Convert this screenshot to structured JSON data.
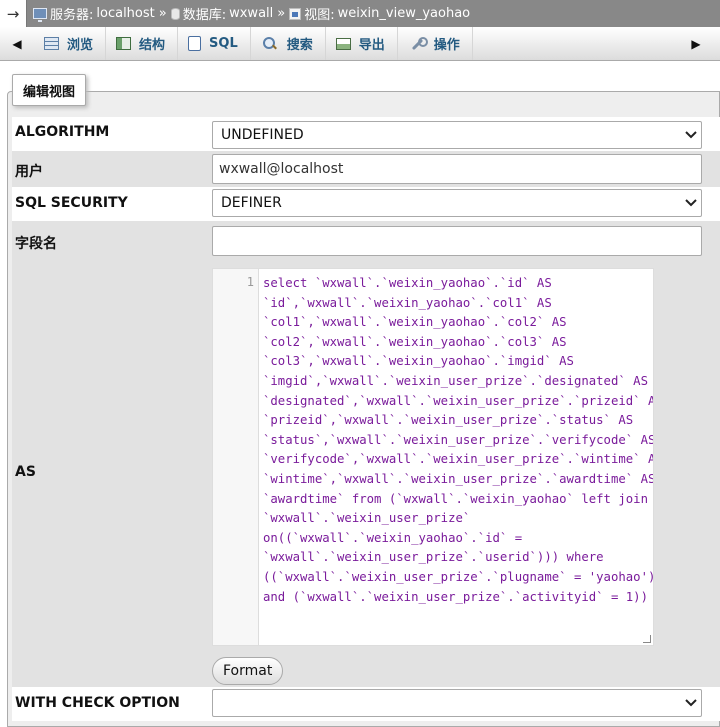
{
  "breadcrumb": {
    "server_label": "服务器:",
    "server_value": "localhost",
    "db_label": "数据库:",
    "db_value": "wxwall",
    "view_label": "视图:",
    "view_value": "weixin_view_yaohao",
    "sep": "»"
  },
  "tabs": [
    {
      "label": "浏览",
      "icon": "browse-icon"
    },
    {
      "label": "结构",
      "icon": "structure-icon"
    },
    {
      "label": "SQL",
      "icon": "sql-icon"
    },
    {
      "label": "搜索",
      "icon": "search-icon"
    },
    {
      "label": "导出",
      "icon": "export-icon"
    },
    {
      "label": "操作",
      "icon": "wrench-icon"
    }
  ],
  "fieldset": {
    "legend": "编辑视图"
  },
  "form": {
    "algorithm_label": "ALGORITHM",
    "algorithm_value": "UNDEFINED",
    "user_label": "用户",
    "user_value": "wxwall@localhost",
    "security_label": "SQL SECURITY",
    "security_value": "DEFINER",
    "column_names_label": "字段名",
    "column_names_value": "",
    "as_label": "AS",
    "as_line_number": "1",
    "as_code_lines": [
      "select `wxwall`.`weixin_yaohao`.`id` AS",
      "`id`,`wxwall`.`weixin_yaohao`.`col1` AS",
      "`col1`,`wxwall`.`weixin_yaohao`.`col2` AS",
      "`col2`,`wxwall`.`weixin_yaohao`.`col3` AS",
      "`col3`,`wxwall`.`weixin_yaohao`.`imgid` AS",
      "`imgid`,`wxwall`.`weixin_user_prize`.`designated` AS",
      "`designated`,`wxwall`.`weixin_user_prize`.`prizeid` AS",
      "`prizeid`,`wxwall`.`weixin_user_prize`.`status` AS",
      "`status`,`wxwall`.`weixin_user_prize`.`verifycode` AS",
      "`verifycode`,`wxwall`.`weixin_user_prize`.`wintime` AS",
      "`wintime`,`wxwall`.`weixin_user_prize`.`awardtime` AS",
      "`awardtime` from (`wxwall`.`weixin_yaohao` left join",
      "`wxwall`.`weixin_user_prize`",
      "on((`wxwall`.`weixin_yaohao`.`id` =",
      "`wxwall`.`weixin_user_prize`.`userid`))) where",
      "((`wxwall`.`weixin_user_prize`.`plugname` = 'yaohao')",
      "and (`wxwall`.`weixin_user_prize`.`activityid` = 1))"
    ],
    "format_button": "Format",
    "check_option_label": "WITH CHECK OPTION",
    "check_option_value": ""
  },
  "colors": {
    "breadcrumb_bg": "#888888",
    "tab_text": "#235a81",
    "code_keyword": "#7a1b9b",
    "code_string": "#aa1111"
  }
}
